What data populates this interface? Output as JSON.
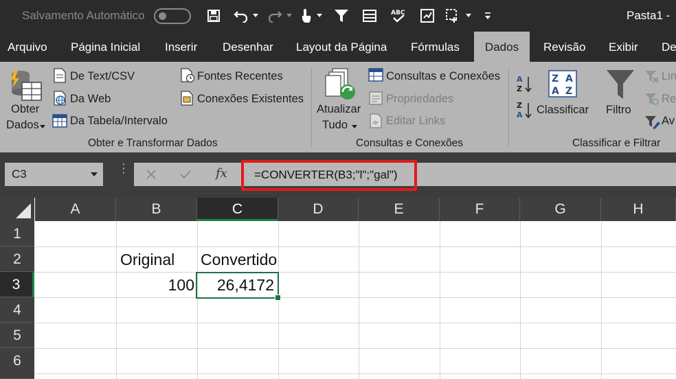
{
  "titlebar": {
    "autosave_label": "Salvamento Automático",
    "document_title": "Pasta1  -"
  },
  "tabs": [
    "Arquivo",
    "Página Inicial",
    "Inserir",
    "Desenhar",
    "Layout da Página",
    "Fórmulas",
    "Dados",
    "Revisão",
    "Exibir",
    "De"
  ],
  "active_tab": "Dados",
  "ribbon": {
    "get_data": {
      "line1": "Obter",
      "line2": "Dados"
    },
    "from_text": "De Text/CSV",
    "from_web": "Da Web",
    "from_table": "Da Tabela/Intervalo",
    "recent_sources": "Fontes Recentes",
    "existing_connections": "Conexões Existentes",
    "group_get_transform": "Obter e Transformar Dados",
    "refresh_all": {
      "line1": "Atualizar",
      "line2": "Tudo"
    },
    "queries_connections": "Consultas e Conexões",
    "properties": "Propriedades",
    "edit_links": "Editar Links",
    "group_queries": "Consultas e Conexões",
    "sort": "Classificar",
    "filter": "Filtro",
    "clear_partial": "Lin",
    "reapply_partial": "Re",
    "advanced_partial": "Av",
    "group_sort_filter": "Classificar e Filtrar"
  },
  "formula_bar": {
    "name_box": "C3",
    "fx": "fx",
    "formula": "=CONVERTER(B3;\"l\";\"gal\")"
  },
  "grid": {
    "columns": [
      "A",
      "B",
      "C",
      "D",
      "E",
      "F",
      "G",
      "H"
    ],
    "rows": [
      "1",
      "2",
      "3",
      "4",
      "5",
      "6"
    ],
    "selected_column": "C",
    "selected_row": "3",
    "cells": {
      "B2": "Original",
      "C2": "Convertido",
      "B3": "100",
      "C3": "26,4172"
    }
  },
  "colors": {
    "accent_green": "#1e7145",
    "highlight_red": "#e21b1b",
    "ribbon_bg": "#b5b5b5"
  }
}
